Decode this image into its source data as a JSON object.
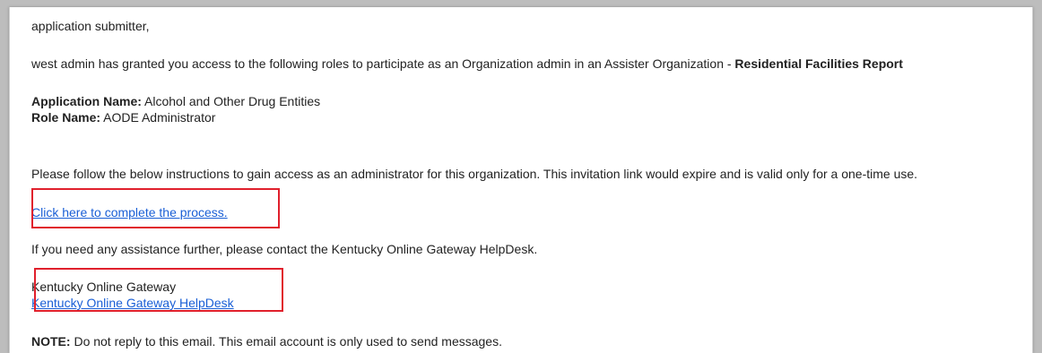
{
  "email": {
    "greeting": "application submitter,",
    "intro_text": "west admin has granted you access to the following roles to participate as an Organization admin in an Assister Organization - ",
    "intro_org": "Residential Facilities Report",
    "app_name_label": "Application Name:",
    "app_name_value": " Alcohol and Other Drug Entities",
    "role_name_label": "Role Name:",
    "role_name_value": " AODE Administrator",
    "instructions": "Please follow the below instructions to gain access as an administrator for this organization. This invitation link would expire and is valid only for a one-time use.",
    "complete_link": "Click here to complete the process.",
    "assistance": "If you need any assistance further, please contact the Kentucky Online Gateway HelpDesk.",
    "signature_name": "Kentucky Online Gateway",
    "helpdesk_link": "Kentucky Online Gateway HelpDesk",
    "note_label": "NOTE:",
    "note_text": " Do not reply to this email. This email account is only used to send messages."
  },
  "colors": {
    "link": "#1a5fd6",
    "highlight": "#e0202c",
    "text": "#222222"
  }
}
